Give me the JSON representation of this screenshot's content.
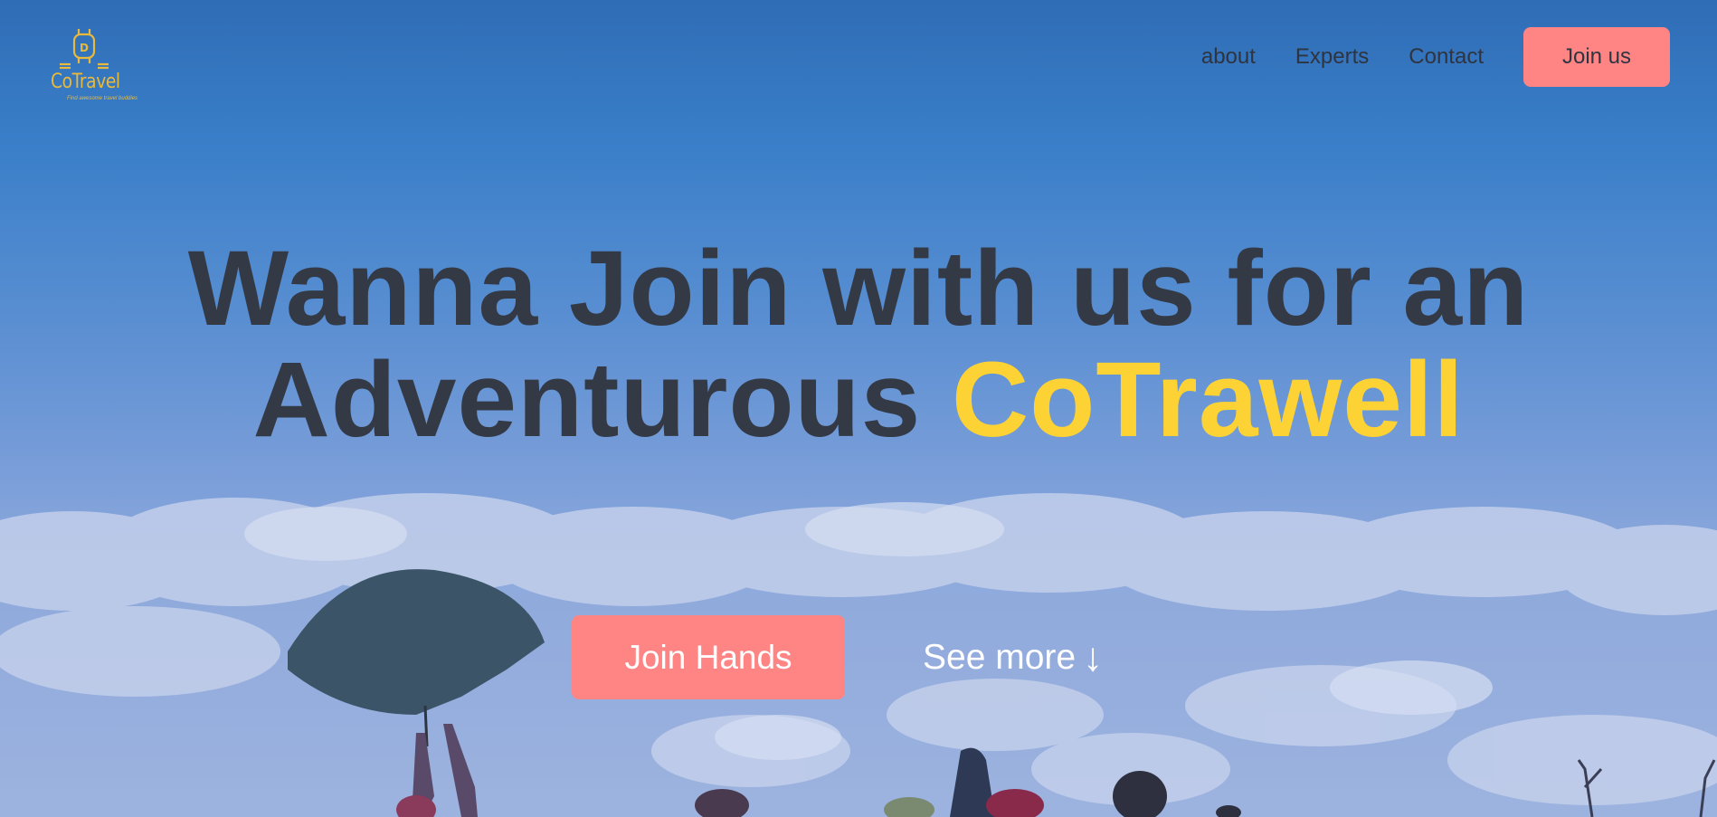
{
  "brand": {
    "name": "CoTravel",
    "tagline": "Find awesome travel buddies",
    "color": "#e8b93a"
  },
  "nav": {
    "links": [
      "about",
      "Experts",
      "Contact"
    ],
    "cta_label": "Join us"
  },
  "hero": {
    "headline_line1": "Wanna Join with us for an",
    "headline_line2_prefix": "Adventurous ",
    "headline_accent": "CoTrawell",
    "primary_button": "Join Hands",
    "secondary_link": "See more",
    "secondary_arrow": "↓"
  },
  "colors": {
    "accent": "#fdd235",
    "button": "#ff8585",
    "text_dark": "#343a45",
    "sky": "#3a7fc9"
  }
}
